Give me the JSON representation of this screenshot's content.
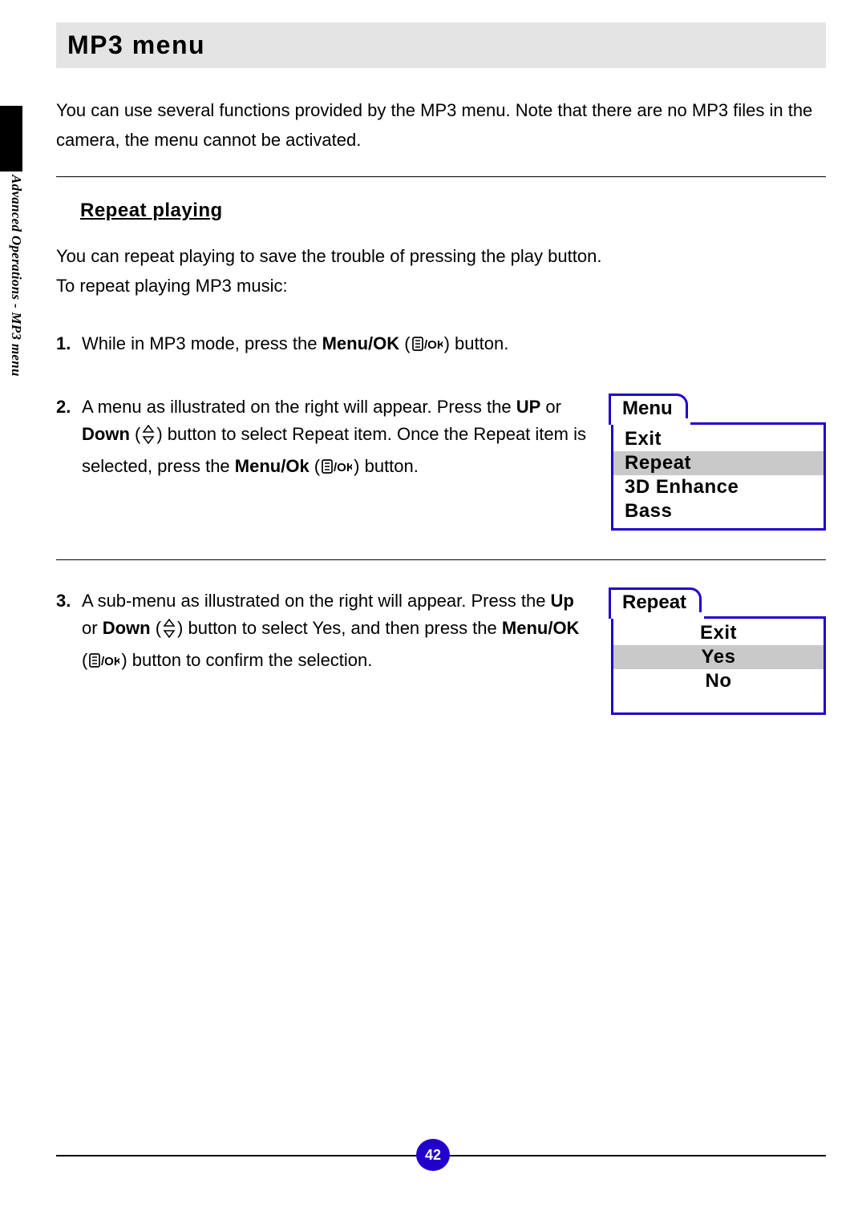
{
  "side_label": "Advanced Operations - MP3 menu",
  "title": "MP3 menu",
  "intro": "You can use several functions provided by the MP3 menu. Note that there are no MP3 files in the camera, the menu cannot be activated.",
  "subhead": "Repeat playing",
  "intro2_line1": "You can repeat playing to save the trouble of pressing the play button.",
  "intro2_line2": "To repeat playing MP3 music:",
  "step1_pre": "While in MP3 mode, press the ",
  "step1_bold": "Menu/OK",
  "step1_post": " button.",
  "step2_l1_pre": "A menu as illustrated on the right will appear. Press the ",
  "step2_l1_up": "UP",
  "step2_l1_or": " or ",
  "step2_l1_down": "Down",
  "step2_l1_post": " button to select Repeat item. Once the Repeat item is selected, press the ",
  "step2_bold": "Menu/Ok",
  "step2_end": " button.",
  "step3_l1": "A sub-menu as illustrated on the right will appear. Press the ",
  "step3_up": "Up",
  "step3_or": " or ",
  "step3_down": "Down",
  "step3_mid": " button to select Yes, and then press the ",
  "step3_bold": "Menu/OK",
  "step3_end": " button to confirm the selection.",
  "menu1": {
    "tab": "Menu",
    "items": [
      "Exit",
      "Repeat",
      "3D Enhance",
      "Bass"
    ],
    "selected_index": 1
  },
  "menu2": {
    "tab": "Repeat",
    "items": [
      "Exit",
      "Yes",
      "No"
    ],
    "selected_index": 1
  },
  "page_number": "42",
  "numbers": {
    "n1": "1.",
    "n2": "2.",
    "n3": "3."
  },
  "paren_open": " (",
  "paren_close": ") "
}
